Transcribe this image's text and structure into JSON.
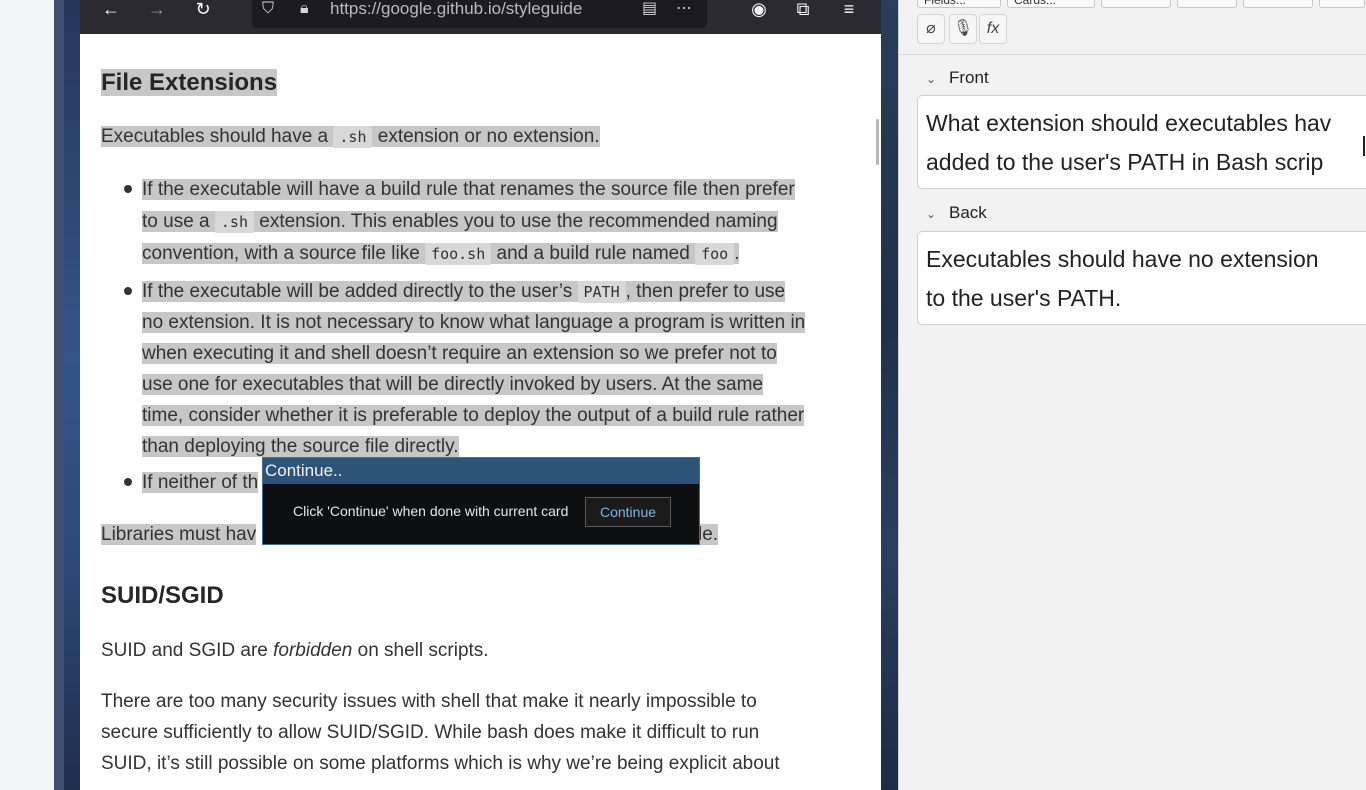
{
  "browser": {
    "url": "https://google.github.io/styleguide",
    "icons": [
      "back-icon",
      "forward-icon",
      "reload-icon",
      "shield-icon",
      "lock-icon",
      "reader-icon",
      "more-icon",
      "account-icon",
      "extensions-icon",
      "menu-icon"
    ]
  },
  "article": {
    "heading1": "File Extensions",
    "intro": {
      "pre": "Executables should have a ",
      "code": ".sh",
      "post": " extension or no extension."
    },
    "bullet1": {
      "l1": "If the executable will have a build rule that renames the source file then prefer",
      "l2_pre": "to use a ",
      "l2_code": ".sh",
      "l2_post": " extension. This enables you to use the recommended naming",
      "l3_pre": "convention, with a source file like ",
      "l3_code1": "foo.sh",
      "l3_mid": " and a build rule named ",
      "l3_code2": "foo",
      "l3_post": "."
    },
    "bullet2": {
      "l1_pre": "If the executable will be added directly to the user’s ",
      "l1_code": "PATH",
      "l1_post": ", then prefer to use",
      "l2": "no extension. It is not necessary to know what language a program is written in",
      "l3": "when executing it and shell doesn’t require an extension so we prefer not to",
      "l4": "use one for executables that will be directly invoked by users. At the same",
      "l5": "time, consider whether it is preferable to deploy the output of a build rule rather",
      "l6": "than deploying the source file directly."
    },
    "bullet3_visible": "If neither of th",
    "libraries_visible_pre": "Libraries must hav",
    "libraries_visible_post": "le.",
    "heading2": "SUID/SGID",
    "suid": {
      "pre": "SUID and SGID are ",
      "em": "forbidden",
      "post": " on shell scripts."
    },
    "security": {
      "l1": "There are too many security issues with shell that make it nearly impossible to",
      "l2": "secure sufficiently to allow SUID/SGID. While bash does make it difficult to run",
      "l3": "SUID, it’s still possible on some platforms which is why we’re being explicit about"
    }
  },
  "dialog": {
    "title": "Continue..",
    "message": "Click 'Continue' when done with current card",
    "button": "Continue"
  },
  "anki": {
    "top_buttons": [
      "Fields...",
      "Cards..."
    ],
    "icon_buttons": [
      "paperclip-icon",
      "microphone-icon",
      "formula-icon"
    ],
    "formula_glyph": "fx",
    "front_label": "Front",
    "front_text_l1": "What extension should executables hav",
    "front_text_l2": "added to the user's PATH in Bash scrip",
    "back_label": "Back",
    "back_text_l1": "Executables should have no extension",
    "back_text_l2": "to the user's PATH."
  }
}
